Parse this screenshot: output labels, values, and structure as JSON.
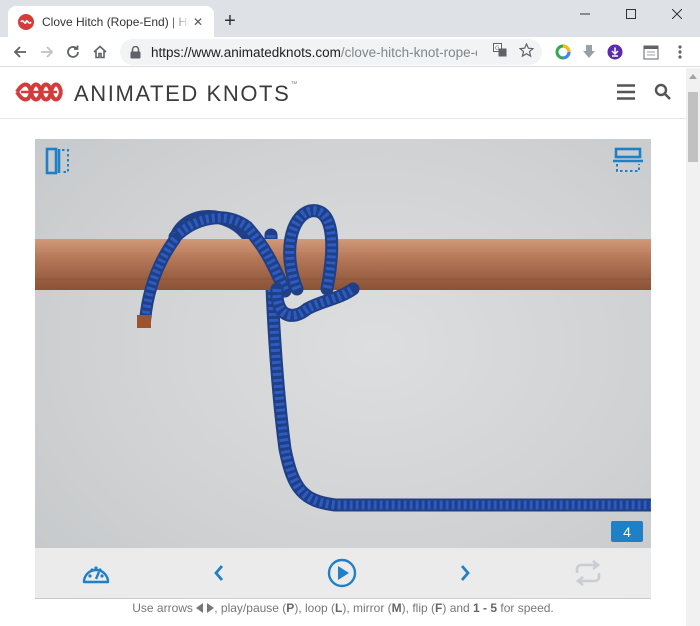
{
  "browser": {
    "tab_title": "Clove Hitch (Rope-End) | How to Tie a Clove Hitch",
    "new_tab_label": "+",
    "url_host": "https://www.animatedknots.com",
    "url_path": "/clove-hitch-knot-rope-e..."
  },
  "site": {
    "logo_text": "ANIMATED KNOTS",
    "logo_tm": "™",
    "brand_color": "#d43b3b",
    "accent_color": "#1f80c8"
  },
  "player": {
    "frame_number": "4",
    "icons": {
      "top_left": "split-view-icon",
      "top_right": "flip-horizontal-icon",
      "speed": "speedometer-icon",
      "prev": "chevron-left-icon",
      "play": "play-circle-icon",
      "next": "chevron-right-icon",
      "loop": "loop-icon"
    }
  },
  "hint": {
    "p1": "Use arrows ",
    "p2": ", play/pause (",
    "k1": "P",
    "p3": "), loop (",
    "k2": "L",
    "p4": "), mirror (",
    "k3": "M",
    "p5": "), flip (",
    "k4": "F",
    "p6": ") and ",
    "k5": "1 - 5",
    "p7": " for speed."
  }
}
